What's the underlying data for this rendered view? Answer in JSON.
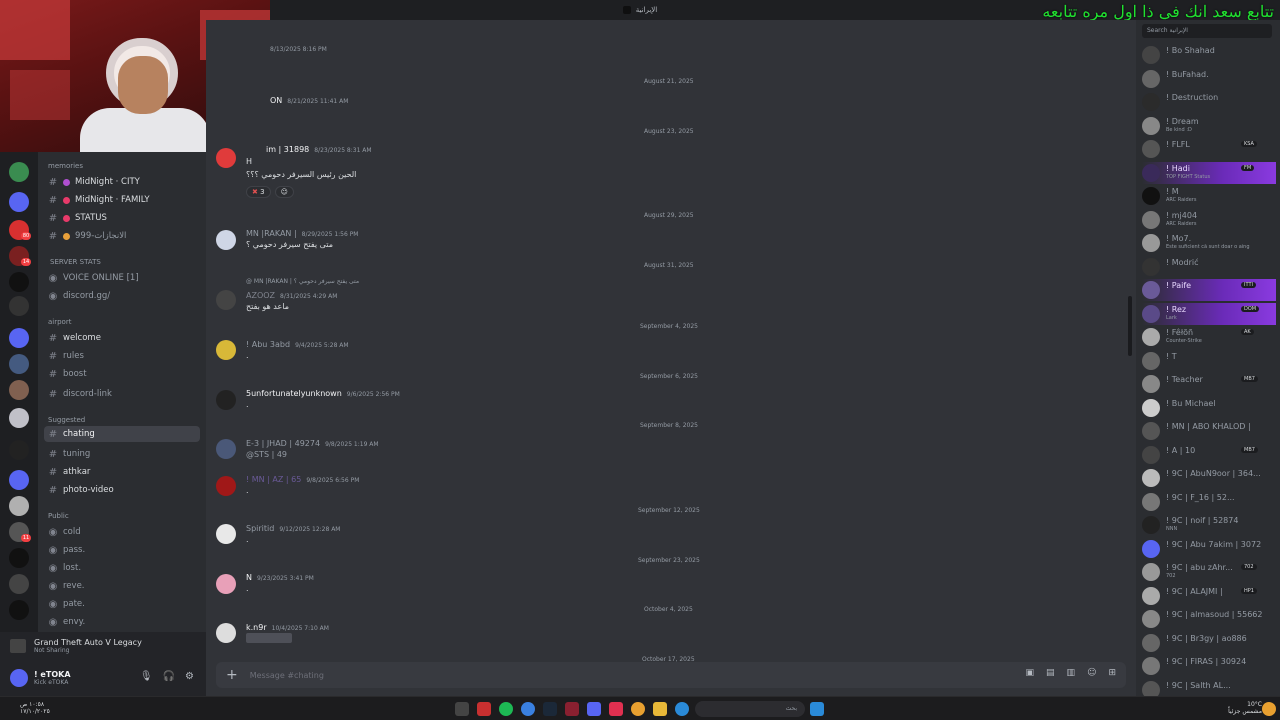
{
  "window": {
    "title": "الإبرانية"
  },
  "overlay": {
    "caption": "تتابع سعد انك في ذا اول مره تتابعه"
  },
  "colors": {
    "accent": "#5865f2",
    "online": "#23a55a",
    "dnd": "#f23f42",
    "highlight": "#8a3ae0",
    "caption_green": "#20e030"
  },
  "sidebar": {
    "categories": [
      "memories",
      "airport",
      "Suggested",
      "Public"
    ],
    "server_stats_label": "SERVER STATS",
    "items": [
      {
        "label": "MidNight · CITY",
        "dot": "#b04fd0"
      },
      {
        "label": "MidNight · FAMILY",
        "dot": "#e83a6a"
      },
      {
        "label": "STATUS",
        "dot": "#e83a6a"
      },
      {
        "label": "الانجازات-999",
        "dot": "#e8a03a"
      }
    ],
    "voice_online": "VOICE ONLINE [1]",
    "discord_gg": "discord.gg/",
    "airport_items": [
      "welcome",
      "rules",
      "boost",
      "discord-link"
    ],
    "suggested_items": [
      "chating",
      "tuning",
      "athkar",
      "photo-video"
    ],
    "public_items": [
      "cold",
      "pass.",
      "lost.",
      "reve.",
      "pate.",
      "envy."
    ],
    "mention_badges": [
      "80",
      "14",
      "11"
    ]
  },
  "activity": {
    "title": "Grand Theft Auto V Legacy",
    "sub": "Not Sharing"
  },
  "user": {
    "name": "! eTOKA",
    "sub": "Kick eTOKA"
  },
  "chat": {
    "top_timestamp": "8/13/2025 8:16 PM",
    "dates": [
      "August 21, 2025",
      "August 23, 2025",
      "August 29, 2025",
      "August 31, 2025",
      "September 4, 2025",
      "September 6, 2025",
      "September 8, 2025",
      "September 12, 2025",
      "September 23, 2025",
      "October 4, 2025",
      "October 17, 2025"
    ],
    "messages": [
      {
        "author": "ON",
        "ts": "8/21/2025 11:41 AM",
        "text": ""
      },
      {
        "author": "im | 31898",
        "ts": "8/23/2025 8:31 AM",
        "text": "H",
        "text2": "الحين رئيس السيرفر دحومي ؟؟؟"
      },
      {
        "author": "MN |RAKAN |",
        "ts": "8/29/2025 1:56 PM",
        "text": "متى يفتح سيرفر دحومي ؟"
      },
      {
        "author": "AZOOZ",
        "ts": "8/31/2025 4:29 AM",
        "text": "ماعد هو بفتح",
        "reply": "@ MN |RAKAN | متى يفتح سيرفر دحومي ؟"
      },
      {
        "author": "! Abu 3abd",
        "ts": "9/4/2025 5:28 AM",
        "text": "."
      },
      {
        "author": "5unfortunatelyunknown",
        "ts": "9/6/2025 2:56 PM",
        "text": "."
      },
      {
        "author": "E-3 | JHAD | 49274",
        "ts": "9/8/2025 1:19 AM",
        "text": "@STS | 49"
      },
      {
        "author": "! MN | AZ | 65",
        "ts": "9/8/2025 6:56 PM",
        "text": "."
      },
      {
        "author": "Spiritid",
        "ts": "9/12/2025 12:28 AM",
        "text": "."
      },
      {
        "author": "N",
        "ts": "9/23/2025 3:41 PM",
        "text": "."
      },
      {
        "author": "k.n9r",
        "ts": "10/4/2025 7:10 AM",
        "text": ""
      }
    ],
    "reactions": [
      "3"
    ],
    "composer_placeholder": "Message #chating"
  },
  "members": {
    "search_placeholder": "Search الإبرانية",
    "list": [
      {
        "name": "! Bo Shahad",
        "sub": ""
      },
      {
        "name": "! BuFahad.",
        "sub": ""
      },
      {
        "name": "! Destruction",
        "sub": ""
      },
      {
        "name": "! Dream",
        "sub": "Be kind :D"
      },
      {
        "name": "! FLFL",
        "sub": "",
        "pill": "KSA"
      },
      {
        "name": "! Hadi",
        "sub": "TOP FIGHT Status",
        "pill": "FM",
        "hl": true
      },
      {
        "name": "! M",
        "sub": "ARC Raiders"
      },
      {
        "name": "! mj404",
        "sub": "ARC Raiders"
      },
      {
        "name": "! Mo7.",
        "sub": "Este suficient că sunt doar o aing"
      },
      {
        "name": "! Modrić",
        "sub": ""
      },
      {
        "name": "! Paife",
        "sub": "",
        "pill": "ITTI",
        "hl": true
      },
      {
        "name": "! Rez",
        "sub": "Lark",
        "pill": "DOM",
        "hl": true
      },
      {
        "name": "! Fêłõñ",
        "sub": "Counter-Strike",
        "pill": "AK"
      },
      {
        "name": "! T",
        "sub": ""
      },
      {
        "name": "! Teacher",
        "sub": "",
        "pill": "MB7"
      },
      {
        "name": "! Bu Michael",
        "sub": ""
      },
      {
        "name": "! MN | ABO KHALOD |",
        "sub": ""
      },
      {
        "name": "! A | 10",
        "sub": "",
        "pill": "MB7"
      },
      {
        "name": "! 9C | AbuN9oor | 364...",
        "sub": ""
      },
      {
        "name": "! 9C | F_16 | 52...",
        "sub": ""
      },
      {
        "name": "! 9C | noif | 52874",
        "sub": "NNN"
      },
      {
        "name": "! 9C | Abu 7akim | 3072",
        "sub": ""
      },
      {
        "name": "! 9C | abu zAhr...",
        "sub": "702",
        "pill": "702"
      },
      {
        "name": "! 9C | ALAJMI |",
        "sub": "",
        "pill": "HP1"
      },
      {
        "name": "! 9C | almasoud | 55662",
        "sub": ""
      },
      {
        "name": "! 9C | Br3gy | ao886",
        "sub": ""
      },
      {
        "name": "! 9C | FIRAS | 30924",
        "sub": ""
      },
      {
        "name": "! 9C | Salth AL...",
        "sub": ""
      }
    ]
  },
  "taskbar": {
    "time": "١٠:٥٨ ص",
    "date": "١٧/١٠/٢٠٢٥",
    "search_placeholder": "بحث",
    "weather": "10°C",
    "weather_sub": "مشمس جزئياً"
  }
}
